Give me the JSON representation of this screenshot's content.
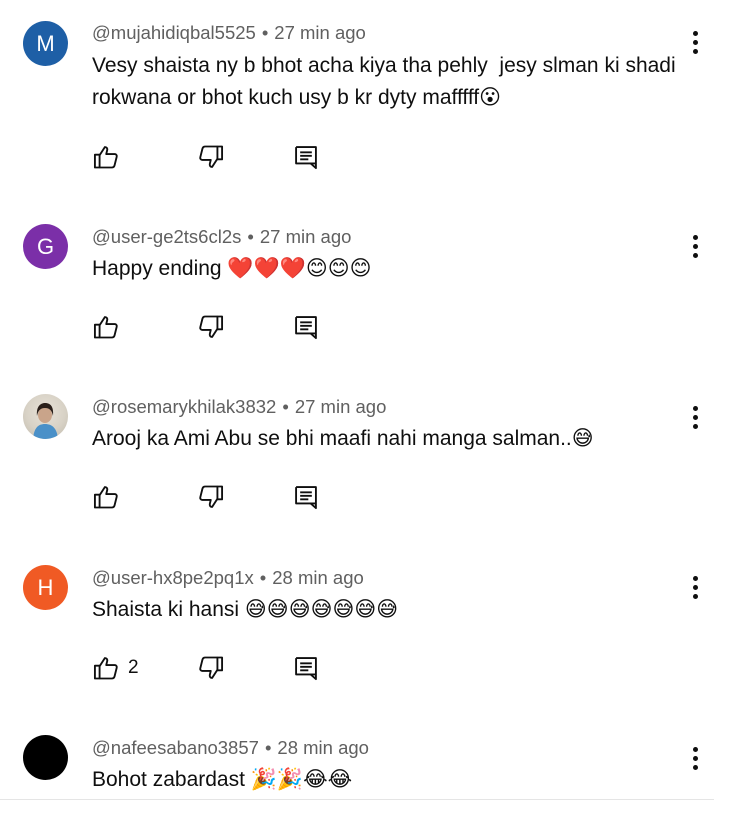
{
  "comments": [
    {
      "avatar_letter": "M",
      "avatar_color": "#1e5fa6",
      "author": "@mujahidiqbal5525",
      "time": "27 min ago",
      "text": "Vesy shaista ny b bhot acha kiya tha pehly  jesy slman ki shadi rokwana or bhot kuch usy b kr dyty mafffff😮",
      "likes": ""
    },
    {
      "avatar_letter": "G",
      "avatar_color": "#7b2fa8",
      "author": "@user-ge2ts6cl2s",
      "time": "27 min ago",
      "text": "Happy ending ❤️❤️❤️😊😊😊",
      "likes": ""
    },
    {
      "avatar_letter": "",
      "avatar_color": "#d9d3c7",
      "author": "@rosemarykhilak3832",
      "time": "27 min ago",
      "text": "Arooj ka Ami Abu se bhi maafi nahi manga salman..😅",
      "likes": ""
    },
    {
      "avatar_letter": "H",
      "avatar_color": "#f05a24",
      "author": "@user-hx8pe2pq1x",
      "time": "28 min ago",
      "text": "Shaista ki hansi 😅😅😅😅😅😅😅",
      "likes": "2"
    },
    {
      "avatar_letter": "",
      "avatar_color": "#000000",
      "author": "@nafeesabano3857",
      "time": "28 min ago",
      "text": "Bohot zabardast 🎉🎉😂😂",
      "likes": ""
    }
  ],
  "separator": "•",
  "icons": {
    "like": "thumbs-up-icon",
    "dislike": "thumbs-down-icon",
    "reply": "reply-icon",
    "more": "more-vert-icon"
  }
}
